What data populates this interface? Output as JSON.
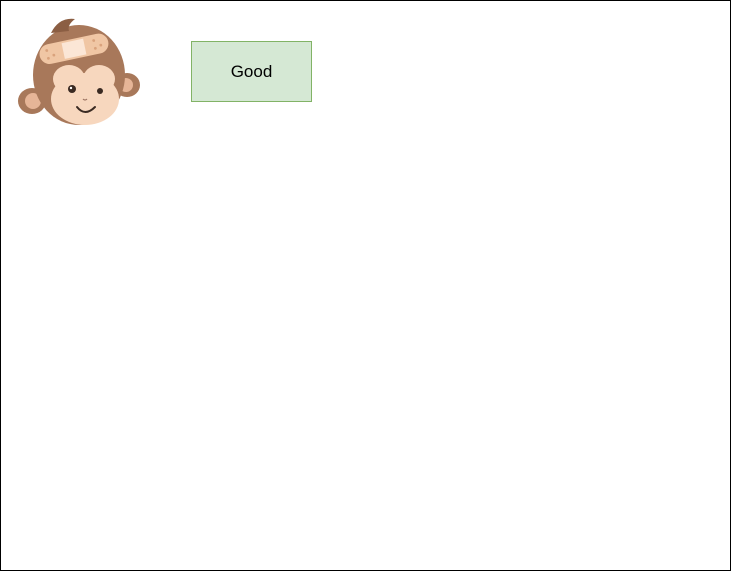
{
  "diagram": {
    "good_box": {
      "label": "Good",
      "fill": "#d5e8d4",
      "stroke": "#82b366"
    },
    "monkey_icon": {
      "icon": "bandaged-monkey-icon",
      "fur_color": "#a8785a",
      "face_color": "#f7d7be",
      "bandage_color": "#f0c6a4"
    }
  }
}
